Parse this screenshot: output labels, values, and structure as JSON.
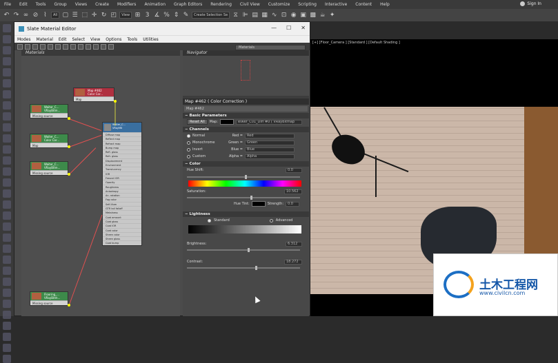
{
  "menu": [
    "File",
    "Edit",
    "Tools",
    "Group",
    "Views",
    "Create",
    "Modifiers",
    "Animation",
    "Graph Editors",
    "Rendering",
    "Civil View",
    "Customize",
    "Scripting",
    "Interactive",
    "Content",
    "Help"
  ],
  "signin": "Sign In",
  "toolbar": {
    "filter_dropdown": "All",
    "view_dropdown": "View",
    "selection_set": "Create Selection Se"
  },
  "sme": {
    "title": "Slate Material Editor",
    "menu": [
      "Modes",
      "Material",
      "Edit",
      "Select",
      "View",
      "Options",
      "Tools",
      "Utilities"
    ],
    "materials_label": "Materials",
    "navigator_label": "Navigator",
    "materials_dropdown": "Materials",
    "nodes": [
      {
        "title": "Map #462",
        "sub": "Color Cor...",
        "row": "Map"
      },
      {
        "title": "Waiter_C...",
        "sub": "VRayBitm...",
        "row": "Missing source"
      },
      {
        "title": "Waiter_C...",
        "sub": "Color Cor...",
        "row": "Map"
      },
      {
        "title": "Waiter_C...",
        "sub": "VRayBitm...",
        "row": "Missing source"
      },
      {
        "title": "Flooring_...",
        "sub": "VRayBitm...",
        "row": "Missing source"
      }
    ],
    "big_node": {
      "title": "Waiter_C...",
      "sub": "VRayMtl",
      "rows": [
        "Diffuse map",
        "Reflect map",
        "Refract map",
        "Bump map",
        "Refl. gloss",
        "Refr. gloss",
        "Displacement",
        "Environment",
        "Translucency",
        "IOR",
        "Fresnel IOR",
        "Opacity",
        "Roughness",
        "Anisotropy",
        "An. rotation",
        "Fog color",
        "Self-illum",
        "GTR tail falloff",
        "Metalness",
        "Coat amount",
        "Coat gloss",
        "Coat IOR",
        "Coat color",
        "Sheen color",
        "Sheen gloss",
        "Coat bump"
      ]
    }
  },
  "params": {
    "header": "Map #462  ( Color Correction )",
    "name": "Map #462",
    "basic_rollout": "Basic Parameters",
    "reset_all": "Reset All",
    "map_label": "Map:",
    "map_value": "eiwer_C01_Diff #0  ( VRayBitmap",
    "channels_rollout": "Channels",
    "channels": [
      {
        "mode": "Normal",
        "ch": "Red =",
        "val": "Red"
      },
      {
        "mode": "Monochrome",
        "ch": "Green =",
        "val": "Green"
      },
      {
        "mode": "Invert",
        "ch": "Blue =",
        "val": "Blue"
      },
      {
        "mode": "Custom",
        "ch": "Alpha =",
        "val": "Alpha"
      }
    ],
    "color_rollout": "Color",
    "hue_shift_label": "Hue Shift:",
    "hue_shift_value": "0.0",
    "saturation_label": "Saturation:",
    "saturation_value": "10.562",
    "hue_tint_label": "Hue Tint:",
    "strength_label": "Strength:",
    "strength_value": "0.0",
    "lightness_rollout": "Lightness",
    "standard": "Standard",
    "advanced": "Advanced",
    "brightness_label": "Brightness:",
    "brightness_value": "6.312",
    "contrast_label": "Contrast:",
    "contrast_value": "18.272"
  },
  "viewport": {
    "label": "[+] [Floor_Camera ] [Standard ] [Default Shading ]"
  },
  "watermark": {
    "title": "土木工程网",
    "url": "www.civilcn.com"
  }
}
